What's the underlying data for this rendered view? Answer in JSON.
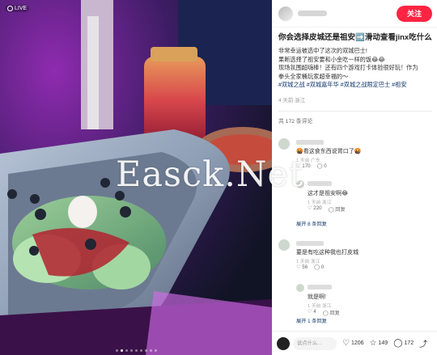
{
  "photo": {
    "live_label": "LIVE",
    "dots_total": 9,
    "dots_active": 2
  },
  "header": {
    "follow_label": "关注"
  },
  "post": {
    "title": "你会选择皮城还是祖安➡️滑动查看jinx吃什么",
    "lines": [
      "非常幸运被选中了这次的双城巴士!",
      "果断选择了祖安要和小金吃一样的饭😂😂",
      "现场氛围超嗨棒！还有四个游戏打卡体验很好玩！作为",
      "拳头全家桶玩家超幸福的～"
    ],
    "tags": "#双城之战 #双城嘉年华 #双城之战限定巴士 #祖安",
    "meta": "4 天前 浙江",
    "comment_count": "共 172 条评论"
  },
  "comments": [
    {
      "text": "🤬看这食东西说胃口了🤬",
      "time": "1 天前 广东",
      "likes": "170",
      "replies": "0"
    },
    {
      "text": "这才是祖安啊😂",
      "time": "1 天前 浙江",
      "likes": "220",
      "replies": "回复",
      "reply": true
    },
    {
      "text": "展开 8 条回复",
      "more": true
    },
    {
      "text": "要是有吃这种我也打皮城",
      "time": "1 天前 浙江",
      "likes": "56",
      "replies": "0"
    },
    {
      "text": "就是啊!",
      "time": "1 天前 浙江",
      "likes": "4",
      "replies": "回复",
      "reply": true
    },
    {
      "text": "展开 1 条回复",
      "more": true
    }
  ],
  "footer": {
    "say_placeholder": "说点什么...",
    "likes": "1206",
    "stars": "149",
    "comments": "172"
  },
  "watermark": "Easck.Net",
  "colors": {
    "accent": "#ff2442",
    "tag": "#13386c"
  }
}
